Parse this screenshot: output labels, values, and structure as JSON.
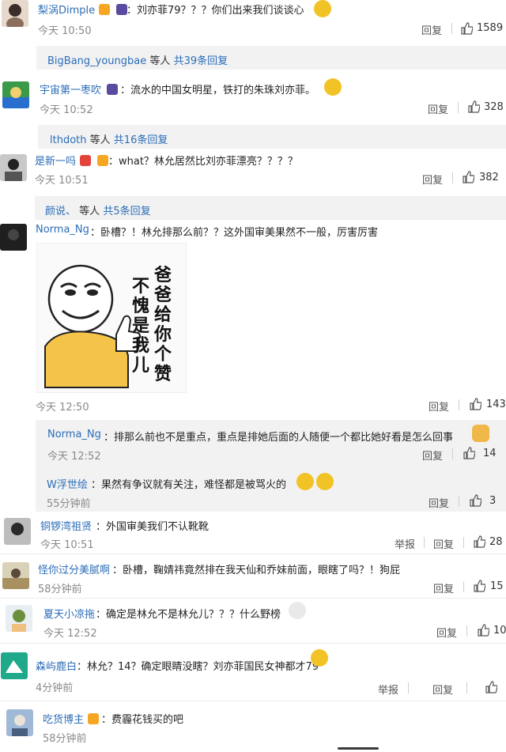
{
  "comments": [
    {
      "user": "梨涡Dimple",
      "text": "：刘亦菲79？？？你们出来我们谈谈心",
      "time": "今天 10:50",
      "reply": "回复",
      "likes": "1589"
    },
    {
      "replies_more": {
        "names": "BigBang_youngbae",
        "mid": "等人",
        "count": "共39条回复"
      }
    },
    {
      "user": "宇宙第一枣吹",
      "text": "：流水的中国女明星，铁打的朱珠刘亦菲。",
      "time": "今天 10:52",
      "reply": "回复",
      "likes": "328"
    },
    {
      "replies_more": {
        "names": "lthdoth",
        "mid": "等人",
        "count": "共16条回复"
      }
    },
    {
      "user": "是新一吗",
      "text": "：what？林允居然比刘亦菲漂亮？？？？",
      "time": "今天 10:51",
      "reply": "回复",
      "likes": "382"
    },
    {
      "replies_more": {
        "names": "颜说、",
        "mid": "等人",
        "count": "共5条回复"
      }
    },
    {
      "user": "Norma_Ng",
      "text": "：卧槽？！林允排那么前？？这外国审美果然不一般，厉害厉害",
      "time": "今天 12:50",
      "reply": "回复",
      "likes": "143",
      "meme": {
        "line1": "爸爸给你个赞",
        "line2": "不愧是我儿"
      }
    },
    {
      "sub_user": "Norma_Ng",
      "sub_text": "：排那么前也不是重点，重点是排她后面的人随便一个都比她好看是怎么回事",
      "sub_time": "今天 12:52",
      "sub_reply": "回复",
      "sub_likes": "14"
    },
    {
      "sub_user": "W浮世绘",
      "sub_text": "：果然有争议就有关注，难怪都是被骂火的",
      "sub_time": "55分钟前",
      "sub_reply": "回复",
      "sub_likes": "3"
    },
    {
      "user": "铜锣湾祖贤",
      "text": "：外国审美我们不认靴靴",
      "time": "今天 10:51",
      "report": "举报",
      "reply": "回复",
      "likes": "28"
    },
    {
      "user": "怪你过分美腻啊",
      "text": "：卧槽，鞠婧祎竟然排在我天仙和乔妹前面，眼瞎了吗？！狗屁",
      "time": "58分钟前",
      "reply": "回复",
      "likes": "15"
    },
    {
      "user": "夏天小凉拖",
      "text": "：确定是林允不是林允儿？？？什么野榜",
      "time": "今天 12:52",
      "reply": "回复",
      "likes": "10"
    },
    {
      "user": "森屿鹿白",
      "text": "：林允？14？确定眼睛没瞎？刘亦菲国民女神都才79",
      "time": "4分钟前",
      "report": "举报",
      "reply": "回复"
    },
    {
      "user": "吃货博主",
      "text": "：费霾花钱买的吧",
      "time": "58分钟前"
    }
  ]
}
